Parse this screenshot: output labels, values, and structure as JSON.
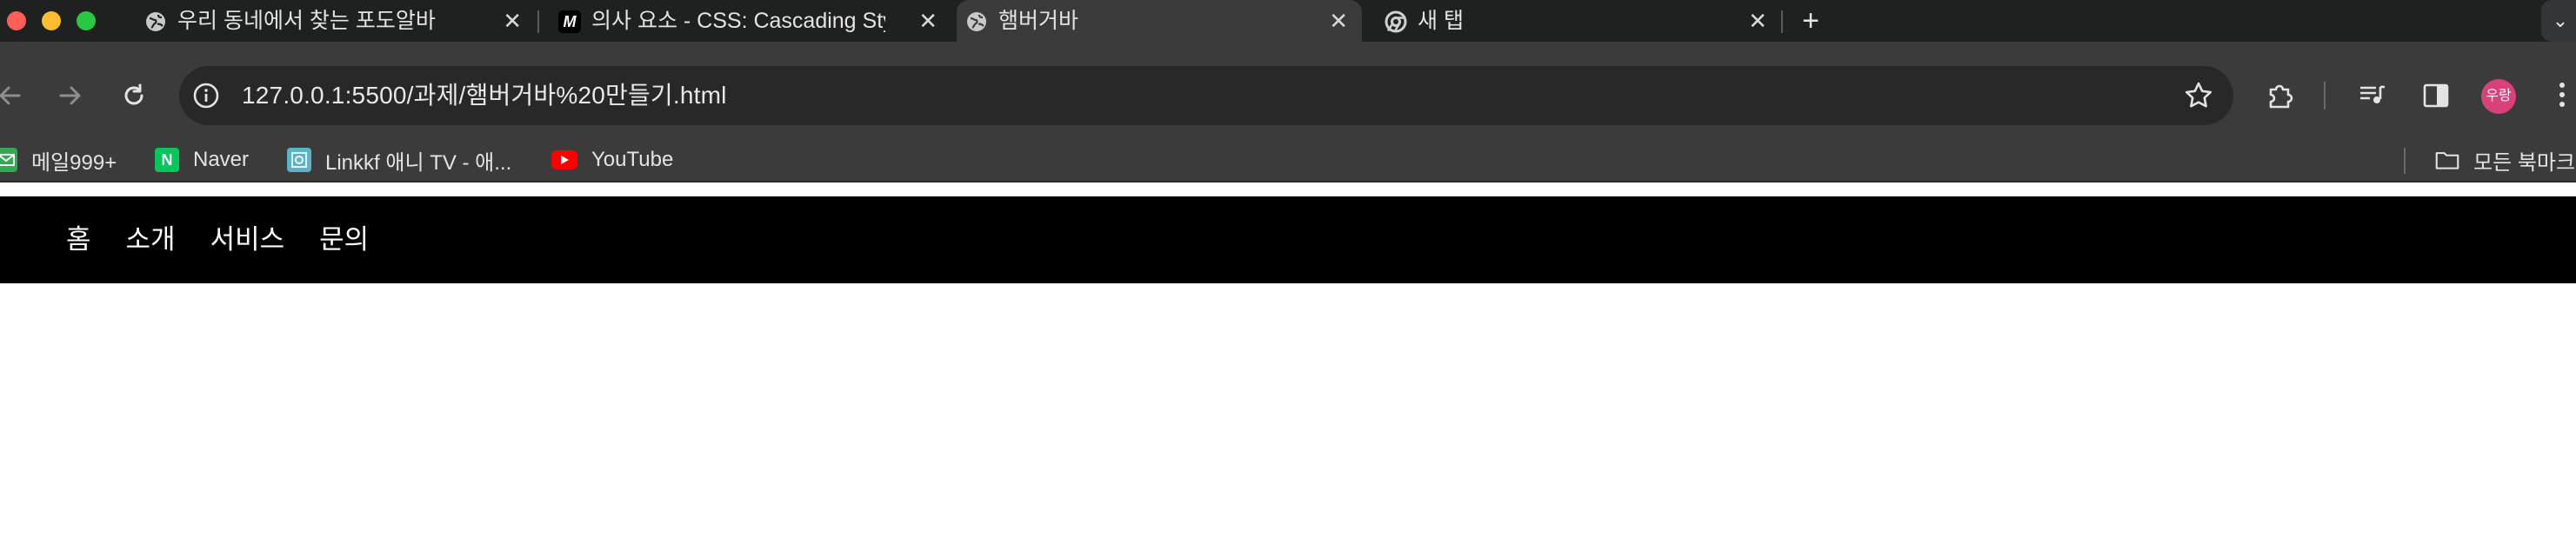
{
  "browser": {
    "tabs": [
      {
        "title": "우리 동네에서 찾는 포도알바",
        "icon": "globe-icon",
        "active": false
      },
      {
        "title": "의사 요소 - CSS: Cascading Style Sheets | MDN",
        "icon": "mdn-icon",
        "active": false
      },
      {
        "title": "햄버거바",
        "icon": "globe-icon",
        "active": true
      },
      {
        "title": "새 탭",
        "icon": "chrome-icon",
        "active": false
      }
    ],
    "close_glyph": "✕",
    "new_tab_glyph": "+",
    "tab_menu_glyph": "⌄",
    "mdn_glyph": "M",
    "address": {
      "url": "127.0.0.1:5500/과제/햄버거바%20만들기.html"
    },
    "profile_label": "우랑",
    "bookmarks": [
      {
        "label": "메일999+",
        "icon": "mail-icon",
        "color": "#34a853"
      },
      {
        "label": "Naver",
        "icon": "naver-icon",
        "color": "#03c75a",
        "glyph": "N"
      },
      {
        "label": "Linkkf 애니 TV - 애...",
        "icon": "linkkf-icon",
        "color": "#5bb3c7"
      },
      {
        "label": "YouTube",
        "icon": "youtube-icon",
        "color": "#ff0000"
      }
    ],
    "all_bookmarks_label": "모든 북마크",
    "colors": {
      "tabstrip": "#1f2020",
      "toolbar": "#3b3b3b",
      "omnibox": "#282828",
      "avatar": "#d8417a"
    }
  },
  "page": {
    "nav": {
      "items": [
        "홈",
        "소개",
        "서비스",
        "문의"
      ],
      "background": "#000000",
      "text_color": "#ffffff"
    }
  }
}
